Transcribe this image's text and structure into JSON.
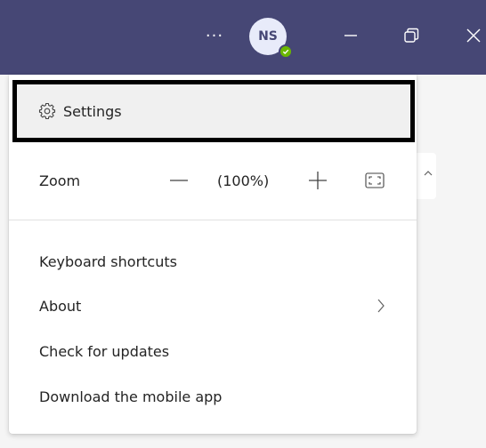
{
  "titlebar": {
    "more_label": "···",
    "avatar_initials": "NS",
    "presence_status": "available",
    "bg_color": "#464775"
  },
  "menu": {
    "settings_label": "Settings",
    "zoom": {
      "label": "Zoom",
      "value": "(100%)"
    },
    "items": [
      {
        "label": "Keyboard shortcuts"
      },
      {
        "label": "About"
      },
      {
        "label": "Check for updates"
      },
      {
        "label": "Download the mobile app"
      }
    ]
  },
  "icons": {
    "settings": "gear-icon",
    "zoom_out": "minus-icon",
    "zoom_in": "plus-icon",
    "fit": "fit-to-screen-icon",
    "about_chevron": "chevron-right-icon"
  }
}
